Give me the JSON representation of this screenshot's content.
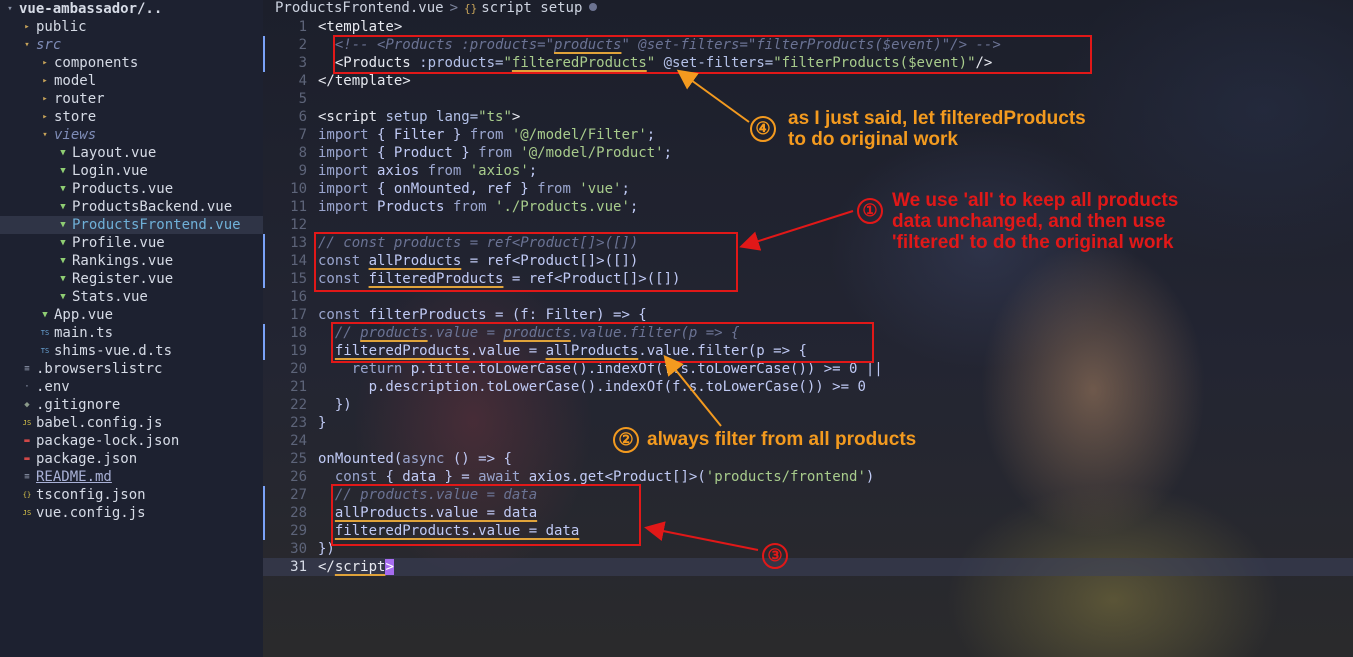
{
  "sidebar": {
    "items": [
      {
        "indent": 0,
        "icon": "chevron-down-icon",
        "glyph": "▾",
        "icon_color": "#8a93a8",
        "label": "vue-ambassador/..",
        "style": "root"
      },
      {
        "indent": 1,
        "icon": "folder-icon",
        "glyph": "▸",
        "icon_color": "#c9a55a",
        "label": "public",
        "style": ""
      },
      {
        "indent": 1,
        "icon": "folder-open-icon",
        "glyph": "▾",
        "icon_color": "#c9a55a",
        "label": "src",
        "style": "italic"
      },
      {
        "indent": 2,
        "icon": "folder-icon",
        "glyph": "▸",
        "icon_color": "#c9a55a",
        "label": "components",
        "style": ""
      },
      {
        "indent": 2,
        "icon": "folder-icon",
        "glyph": "▸",
        "icon_color": "#c9a55a",
        "label": "model",
        "style": ""
      },
      {
        "indent": 2,
        "icon": "folder-icon",
        "glyph": "▸",
        "icon_color": "#c9a55a",
        "label": "router",
        "style": ""
      },
      {
        "indent": 2,
        "icon": "folder-icon",
        "glyph": "▸",
        "icon_color": "#c9a55a",
        "label": "store",
        "style": ""
      },
      {
        "indent": 2,
        "icon": "folder-open-icon",
        "glyph": "▾",
        "icon_color": "#c9a55a",
        "label": "views",
        "style": "italic"
      },
      {
        "indent": 3,
        "icon": "vue-file-icon",
        "glyph": "▼",
        "icon_color": "#8fce73",
        "label": "Layout.vue",
        "style": ""
      },
      {
        "indent": 3,
        "icon": "vue-file-icon",
        "glyph": "▼",
        "icon_color": "#8fce73",
        "label": "Login.vue",
        "style": ""
      },
      {
        "indent": 3,
        "icon": "vue-file-icon",
        "glyph": "▼",
        "icon_color": "#8fce73",
        "label": "Products.vue",
        "style": ""
      },
      {
        "indent": 3,
        "icon": "vue-file-icon",
        "glyph": "▼",
        "icon_color": "#8fce73",
        "label": "ProductsBackend.vue",
        "style": ""
      },
      {
        "indent": 3,
        "icon": "vue-file-icon",
        "glyph": "▼",
        "icon_color": "#8fce73",
        "label": "ProductsFrontend.vue",
        "style": "selected"
      },
      {
        "indent": 3,
        "icon": "vue-file-icon",
        "glyph": "▼",
        "icon_color": "#8fce73",
        "label": "Profile.vue",
        "style": ""
      },
      {
        "indent": 3,
        "icon": "vue-file-icon",
        "glyph": "▼",
        "icon_color": "#8fce73",
        "label": "Rankings.vue",
        "style": ""
      },
      {
        "indent": 3,
        "icon": "vue-file-icon",
        "glyph": "▼",
        "icon_color": "#8fce73",
        "label": "Register.vue",
        "style": ""
      },
      {
        "indent": 3,
        "icon": "vue-file-icon",
        "glyph": "▼",
        "icon_color": "#8fce73",
        "label": "Stats.vue",
        "style": ""
      },
      {
        "indent": 2,
        "icon": "vue-file-icon",
        "glyph": "▼",
        "icon_color": "#8fce73",
        "label": "App.vue",
        "style": ""
      },
      {
        "indent": 2,
        "icon": "typescript-file-icon",
        "glyph": "TS",
        "icon_color": "#6aa5d8",
        "label": "main.ts",
        "style": ""
      },
      {
        "indent": 2,
        "icon": "typescript-file-icon",
        "glyph": "TS",
        "icon_color": "#6aa5d8",
        "label": "shims-vue.d.ts",
        "style": ""
      },
      {
        "indent": 1,
        "icon": "config-file-icon",
        "glyph": "≡",
        "icon_color": "#9aa3b8",
        "label": ".browserslistrc",
        "style": ""
      },
      {
        "indent": 1,
        "icon": "dotfile-icon",
        "glyph": "·",
        "icon_color": "#9aa3b8",
        "label": ".env",
        "style": ""
      },
      {
        "indent": 1,
        "icon": "git-icon",
        "glyph": "◆",
        "icon_color": "#8a9a8a",
        "label": ".gitignore",
        "style": ""
      },
      {
        "indent": 1,
        "icon": "javascript-file-icon",
        "glyph": "JS",
        "icon_color": "#d8c44a",
        "label": "babel.config.js",
        "style": ""
      },
      {
        "indent": 1,
        "icon": "npm-file-icon",
        "glyph": "▬",
        "icon_color": "#d04848",
        "label": "package-lock.json",
        "style": ""
      },
      {
        "indent": 1,
        "icon": "npm-file-icon",
        "glyph": "▬",
        "icon_color": "#d04848",
        "label": "package.json",
        "style": ""
      },
      {
        "indent": 1,
        "icon": "markdown-file-icon",
        "glyph": "≡",
        "icon_color": "#9aa3b8",
        "label": "README.md",
        "style": "underline"
      },
      {
        "indent": 1,
        "icon": "json-file-icon",
        "glyph": "{}",
        "icon_color": "#d8c44a",
        "label": "tsconfig.json",
        "style": ""
      },
      {
        "indent": 1,
        "icon": "javascript-file-icon",
        "glyph": "JS",
        "icon_color": "#d8c44a",
        "label": "vue.config.js",
        "style": ""
      }
    ]
  },
  "editor": {
    "breadcrumb": {
      "file": "ProductsFrontend.vue",
      "separator": ">",
      "symbol_icon": "braces-icon",
      "symbol_glyph": "{}",
      "symbol": "script setup",
      "modified_icon": "dot-icon"
    },
    "current_line": 31,
    "lines": [
      {
        "n": 1,
        "tokens": [
          [
            "tag",
            "<template>"
          ]
        ]
      },
      {
        "n": 2,
        "tokens": [
          [
            "cm",
            "  <!-- <Products :products=\""
          ],
          [
            "cm ul",
            "products"
          ],
          [
            "cm",
            "\" @set-filters=\"filterProducts($event)\"/> -->"
          ]
        ]
      },
      {
        "n": 3,
        "tokens": [
          [
            "tag",
            "  <Products "
          ],
          [
            "attr",
            ":products="
          ],
          [
            "str",
            "\""
          ],
          [
            "str ul",
            "filteredProducts"
          ],
          [
            "str",
            "\""
          ],
          [
            "attr",
            " @set-filters="
          ],
          [
            "str",
            "\"filterProducts($event)\""
          ],
          [
            "tag",
            "/>"
          ]
        ]
      },
      {
        "n": 4,
        "tokens": [
          [
            "tag",
            "</template>"
          ]
        ]
      },
      {
        "n": 5,
        "tokens": []
      },
      {
        "n": 6,
        "tokens": [
          [
            "tag",
            "<script"
          ],
          [
            "attr",
            " setup lang="
          ],
          [
            "str",
            "\"ts\""
          ],
          [
            "tag",
            ">"
          ]
        ]
      },
      {
        "n": 7,
        "tokens": [
          [
            "kw",
            "import"
          ],
          [
            "id",
            " { Filter } "
          ],
          [
            "kw",
            "from"
          ],
          [
            "str",
            " '@/model/Filter'"
          ],
          [
            "id",
            ";"
          ]
        ]
      },
      {
        "n": 8,
        "tokens": [
          [
            "kw",
            "import"
          ],
          [
            "id",
            " { Product } "
          ],
          [
            "kw",
            "from"
          ],
          [
            "str",
            " '@/model/Product'"
          ],
          [
            "id",
            ";"
          ]
        ]
      },
      {
        "n": 9,
        "tokens": [
          [
            "kw",
            "import"
          ],
          [
            "id",
            " axios "
          ],
          [
            "kw",
            "from"
          ],
          [
            "str",
            " 'axios'"
          ],
          [
            "id",
            ";"
          ]
        ]
      },
      {
        "n": 10,
        "tokens": [
          [
            "kw",
            "import"
          ],
          [
            "id",
            " { onMounted, ref } "
          ],
          [
            "kw",
            "from"
          ],
          [
            "str",
            " 'vue'"
          ],
          [
            "id",
            ";"
          ]
        ]
      },
      {
        "n": 11,
        "tokens": [
          [
            "kw",
            "import"
          ],
          [
            "id",
            " Products "
          ],
          [
            "kw",
            "from"
          ],
          [
            "str",
            " './Products.vue'"
          ],
          [
            "id",
            ";"
          ]
        ]
      },
      {
        "n": 12,
        "tokens": []
      },
      {
        "n": 13,
        "tokens": [
          [
            "cm",
            "// const products = ref<Product[]>([])"
          ]
        ]
      },
      {
        "n": 14,
        "tokens": [
          [
            "kw",
            "const "
          ],
          [
            "id ul",
            "allProducts"
          ],
          [
            "id",
            " = ref<Product[]>([])"
          ]
        ]
      },
      {
        "n": 15,
        "tokens": [
          [
            "kw",
            "const "
          ],
          [
            "id ul",
            "filteredProducts"
          ],
          [
            "id",
            " = ref<Product[]>([])"
          ]
        ]
      },
      {
        "n": 16,
        "tokens": []
      },
      {
        "n": 17,
        "tokens": [
          [
            "kw",
            "const "
          ],
          [
            "id",
            "filterProducts = (f: Filter) => {"
          ]
        ]
      },
      {
        "n": 18,
        "tokens": [
          [
            "cm",
            "  // "
          ],
          [
            "cm ul",
            "products"
          ],
          [
            "cm",
            ".value = "
          ],
          [
            "cm ul",
            "products"
          ],
          [
            "cm",
            ".value.filter(p => {"
          ]
        ]
      },
      {
        "n": 19,
        "tokens": [
          [
            "id",
            "  "
          ],
          [
            "id ul",
            "filteredProducts"
          ],
          [
            "id",
            ".value = "
          ],
          [
            "id ul",
            "allProducts"
          ],
          [
            "id",
            ".value.filter(p => {"
          ]
        ]
      },
      {
        "n": 20,
        "tokens": [
          [
            "kw",
            "    return"
          ],
          [
            "id",
            " p.title.toLowerCase().indexOf(f.s.toLowerCase()) >= 0 ||"
          ]
        ]
      },
      {
        "n": 21,
        "tokens": [
          [
            "id",
            "      p.description.toLowerCase().indexOf(f.s.toLowerCase()) >= 0"
          ]
        ]
      },
      {
        "n": 22,
        "tokens": [
          [
            "id",
            "  })"
          ]
        ]
      },
      {
        "n": 23,
        "tokens": [
          [
            "id",
            "}"
          ]
        ]
      },
      {
        "n": 24,
        "tokens": []
      },
      {
        "n": 25,
        "tokens": [
          [
            "id",
            "onMounted("
          ],
          [
            "kw",
            "async"
          ],
          [
            "id",
            " () => {"
          ]
        ]
      },
      {
        "n": 26,
        "tokens": [
          [
            "kw",
            "  const"
          ],
          [
            "id",
            " { data } = "
          ],
          [
            "kw",
            "await"
          ],
          [
            "id",
            " axios.get<Product[]>("
          ],
          [
            "str",
            "'products/frontend'"
          ],
          [
            "id",
            ")"
          ]
        ]
      },
      {
        "n": 27,
        "tokens": [
          [
            "cm",
            "  // products.value = data"
          ]
        ]
      },
      {
        "n": 28,
        "tokens": [
          [
            "id",
            "  "
          ],
          [
            "id ul",
            "allProducts.value = data"
          ]
        ]
      },
      {
        "n": 29,
        "tokens": [
          [
            "id",
            "  "
          ],
          [
            "id ul",
            "filteredProducts.value = data"
          ]
        ]
      },
      {
        "n": 30,
        "tokens": [
          [
            "id",
            "})"
          ]
        ]
      },
      {
        "n": 31,
        "tokens": [
          [
            "tag",
            "</"
          ],
          [
            "tag ul",
            "script"
          ],
          [
            "cursor",
            ">"
          ]
        ]
      }
    ]
  },
  "annotations": [
    {
      "number": "①",
      "color": "red",
      "lines": [
        "We use 'all' to keep all products",
        "data unchanged, and then use",
        "'filtered' to do the original work"
      ]
    },
    {
      "number": "②",
      "color": "orange",
      "lines": [
        "always filter from all products"
      ]
    },
    {
      "number": "③",
      "color": "red",
      "lines": []
    },
    {
      "number": "④",
      "color": "orange",
      "lines": [
        "as I just said, let filteredProducts",
        "to do original work"
      ]
    }
  ],
  "colors": {
    "accent_red": "#e11818",
    "accent_orange": "#f39a1f",
    "sidebar_bg": "#1d2130",
    "selection": "#2f3446"
  }
}
